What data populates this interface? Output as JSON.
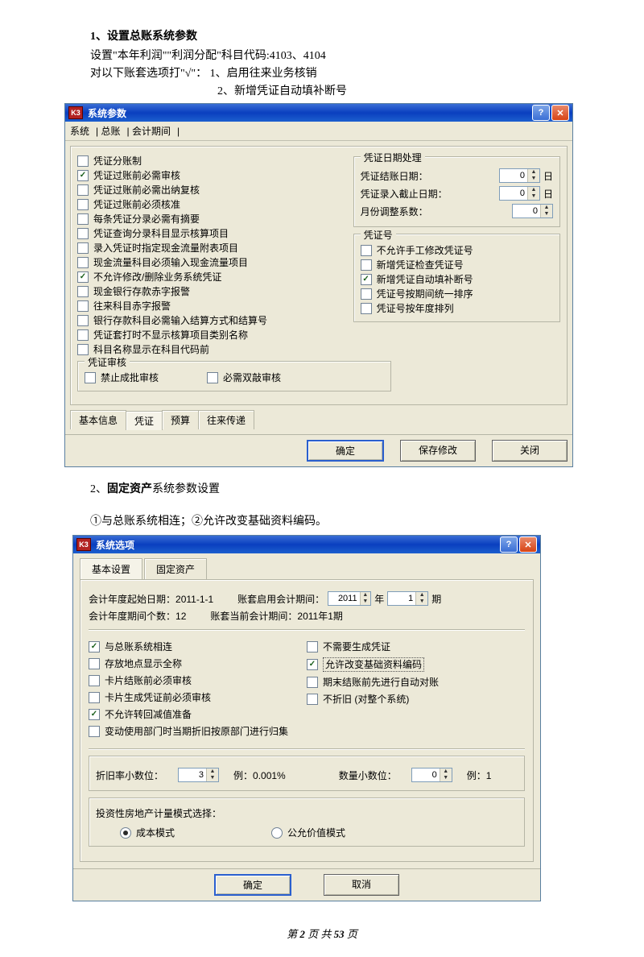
{
  "doc": {
    "heading1": "1、设置总账系统参数",
    "para1": "设置\"本年利润\"\"利润分配\"科目代码:4103、4104",
    "para2": "对以下账套选项打\"√\"：  1、启用往来业务核销",
    "para3": "2、新增凭证自动填补断号",
    "section2_prefix": "2、",
    "section2_bold": "固定资产",
    "section2_suffix": "系统参数设置",
    "subpara": "①与总账系统相连；②允许改变基础资料编码。"
  },
  "win1": {
    "title": "系统参数",
    "appicon": "K3",
    "menus": [
      "系统",
      "总账",
      "会计期间"
    ],
    "left_checks": [
      {
        "label": "凭证分账制",
        "checked": false
      },
      {
        "label": "凭证过账前必需审核",
        "checked": true
      },
      {
        "label": "凭证过账前必需出纳复核",
        "checked": false
      },
      {
        "label": "凭证过账前必须核准",
        "checked": false
      },
      {
        "label": "每条凭证分录必需有摘要",
        "checked": false
      },
      {
        "label": "凭证查询分录科目显示核算项目",
        "checked": false
      },
      {
        "label": "录入凭证时指定现金流量附表项目",
        "checked": false
      },
      {
        "label": "现金流量科目必须输入现金流量项目",
        "checked": false
      },
      {
        "label": "不允许修改/删除业务系统凭证",
        "checked": true
      },
      {
        "label": "现金银行存款赤字报警",
        "checked": false
      },
      {
        "label": "往来科目赤字报警",
        "checked": false
      },
      {
        "label": "银行存款科目必需输入结算方式和结算号",
        "checked": false
      },
      {
        "label": "凭证套打时不显示核算项目类别名称",
        "checked": false
      },
      {
        "label": "科目名称显示在科目代码前",
        "checked": false
      }
    ],
    "audit_group": {
      "legend": "凭证审核",
      "c1": "禁止成批审核",
      "c2": "必需双敲审核"
    },
    "date_group": {
      "legend": "凭证日期处理",
      "row1_label": "凭证结账日期：",
      "row1_val": "0",
      "row1_suffix": "日",
      "row2_label": "凭证录入截止日期：",
      "row2_val": "0",
      "row2_suffix": "日",
      "row3_label": "月份调整系数：",
      "row3_val": "0"
    },
    "num_group": {
      "legend": "凭证号",
      "items": [
        {
          "label": "不允许手工修改凭证号",
          "checked": false
        },
        {
          "label": "新增凭证检查凭证号",
          "checked": false
        },
        {
          "label": "新增凭证自动填补断号",
          "checked": true
        },
        {
          "label": "凭证号按期间统一排序",
          "checked": false
        },
        {
          "label": "凭证号按年度排列",
          "checked": false
        }
      ]
    },
    "tabs": [
      "基本信息",
      "凭证",
      "预算",
      "往来传递"
    ],
    "buttons": {
      "ok": "确定",
      "save": "保存修改",
      "close": "关闭"
    }
  },
  "win2": {
    "title": "系统选项",
    "appicon": "K3",
    "tabs": [
      "基本设置",
      "固定资产"
    ],
    "top": {
      "r1_lbl": "会计年度起始日期：",
      "r1_val": "2011-1-1",
      "r1b_lbl": "账套启用会计期间：",
      "r1b_y": "2011",
      "r1b_y_suf": "年",
      "r1b_p": "1",
      "r1b_p_suf": "期",
      "r2_lbl": "会计年度期间个数：",
      "r2_val": "12",
      "r2b_lbl": "账套当前会计期间：",
      "r2b_val": "2011年1期"
    },
    "checks_left": [
      {
        "label": "与总账系统相连",
        "checked": true
      },
      {
        "label": "存放地点显示全称",
        "checked": false
      },
      {
        "label": "卡片结账前必须审核",
        "checked": false
      },
      {
        "label": "卡片生成凭证前必须审核",
        "checked": false
      },
      {
        "label": "不允许转回减值准备",
        "checked": true
      },
      {
        "label": "变动使用部门时当期折旧按原部门进行归集",
        "checked": false
      }
    ],
    "checks_right": [
      {
        "label": "不需要生成凭证",
        "checked": false
      },
      {
        "label": "允许改变基础资料编码",
        "checked": true,
        "boxed": true
      },
      {
        "label": "期末结账前先进行自动对账",
        "checked": false
      },
      {
        "label": "不折旧 (对整个系统)",
        "checked": false
      }
    ],
    "dec": {
      "lbl1": "折旧率小数位：",
      "val1": "3",
      "ex1": "例：0.001%",
      "lbl2": "数量小数位：",
      "val2": "0",
      "ex2": "例：1"
    },
    "mode": {
      "lbl": "投资性房地产计量模式选择：",
      "r1": "成本模式",
      "r2": "公允价值模式"
    },
    "buttons": {
      "ok": "确定",
      "cancel": "取消"
    }
  },
  "footer": {
    "prefix": "第 ",
    "page": "2",
    "mid": " 页 共 ",
    "total": "53",
    "suffix": " 页"
  }
}
